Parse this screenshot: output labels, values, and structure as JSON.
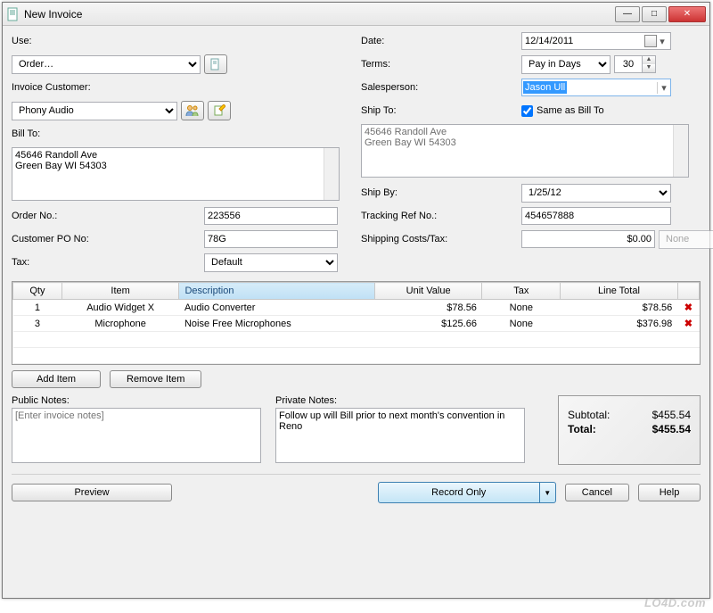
{
  "window": {
    "title": "New Invoice"
  },
  "left": {
    "use_label": "Use:",
    "use_value": "Order…",
    "customer_label": "Invoice Customer:",
    "customer_value": "Phony Audio",
    "bill_to_label": "Bill To:",
    "bill_to_text": "45646 Randoll Ave\nGreen Bay WI 54303",
    "order_no_label": "Order No.:",
    "order_no_value": "223556",
    "po_label": "Customer PO No:",
    "po_value": "78G",
    "tax_label": "Tax:",
    "tax_value": "Default"
  },
  "right": {
    "date_label": "Date:",
    "date_value": "12/14/2011",
    "terms_label": "Terms:",
    "terms_value": "Pay in Days",
    "terms_days": "30",
    "sales_label": "Salesperson:",
    "sales_value": "Jason Ull",
    "ship_to_label": "Ship To:",
    "same_label": "Same as Bill To",
    "ship_to_text": "45646 Randoll Ave\nGreen Bay WI 54303",
    "ship_by_label": "Ship By:",
    "ship_by_value": "1/25/12",
    "tracking_label": "Tracking Ref No.:",
    "tracking_value": "454657888",
    "ship_cost_label": "Shipping Costs/Tax:",
    "ship_cost_value": "$0.00",
    "ship_cost_tax": "None"
  },
  "grid": {
    "headers": {
      "qty": "Qty",
      "item": "Item",
      "desc": "Description",
      "unit": "Unit Value",
      "tax": "Tax",
      "total": "Line Total"
    },
    "rows": [
      {
        "qty": "1",
        "item": "Audio Widget X",
        "desc": "Audio Converter",
        "unit": "$78.56",
        "tax": "None",
        "total": "$78.56"
      },
      {
        "qty": "3",
        "item": "Microphone",
        "desc": "Noise Free Microphones",
        "unit": "$125.66",
        "tax": "None",
        "total": "$376.98"
      }
    ]
  },
  "buttons": {
    "add_item": "Add Item",
    "remove_item": "Remove Item",
    "preview": "Preview",
    "record": "Record Only",
    "cancel": "Cancel",
    "help": "Help"
  },
  "notes": {
    "public_label": "Public Notes:",
    "public_placeholder": "[Enter invoice notes]",
    "private_label": "Private Notes:",
    "private_value": "Follow up will Bill prior to next month's convention in Reno"
  },
  "totals": {
    "subtotal_label": "Subtotal:",
    "subtotal_value": "$455.54",
    "total_label": "Total:",
    "total_value": "$455.54"
  },
  "watermark": "LO4D.com"
}
